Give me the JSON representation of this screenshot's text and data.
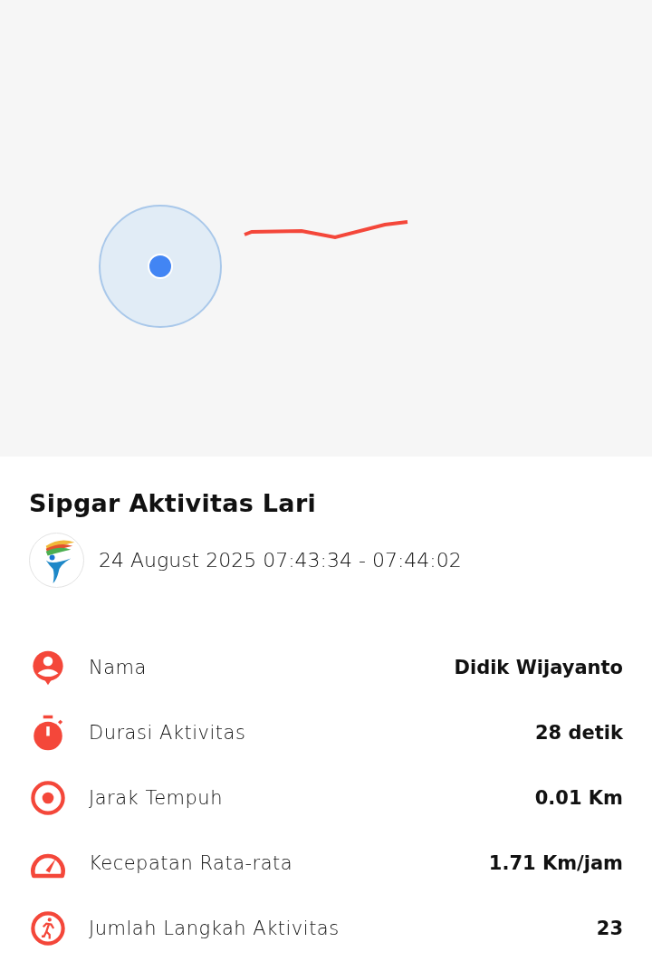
{
  "title": "Sipgar Aktivitas Lari",
  "time_range": "24 August 2025 07:43:34 - 07:44:02",
  "stats": [
    {
      "kind": "person",
      "label": "Nama",
      "value": "Didik Wijayanto"
    },
    {
      "kind": "timer",
      "label": "Durasi Aktivitas",
      "value": "28 detik"
    },
    {
      "kind": "target",
      "label": "Jarak Tempuh",
      "value": "0.01 Km"
    },
    {
      "kind": "speed",
      "label": "Kecepatan Rata-rata",
      "value": "1.71 Km/jam"
    },
    {
      "kind": "run",
      "label": "Jumlah Langkah Aktivitas",
      "value": "23"
    }
  ]
}
